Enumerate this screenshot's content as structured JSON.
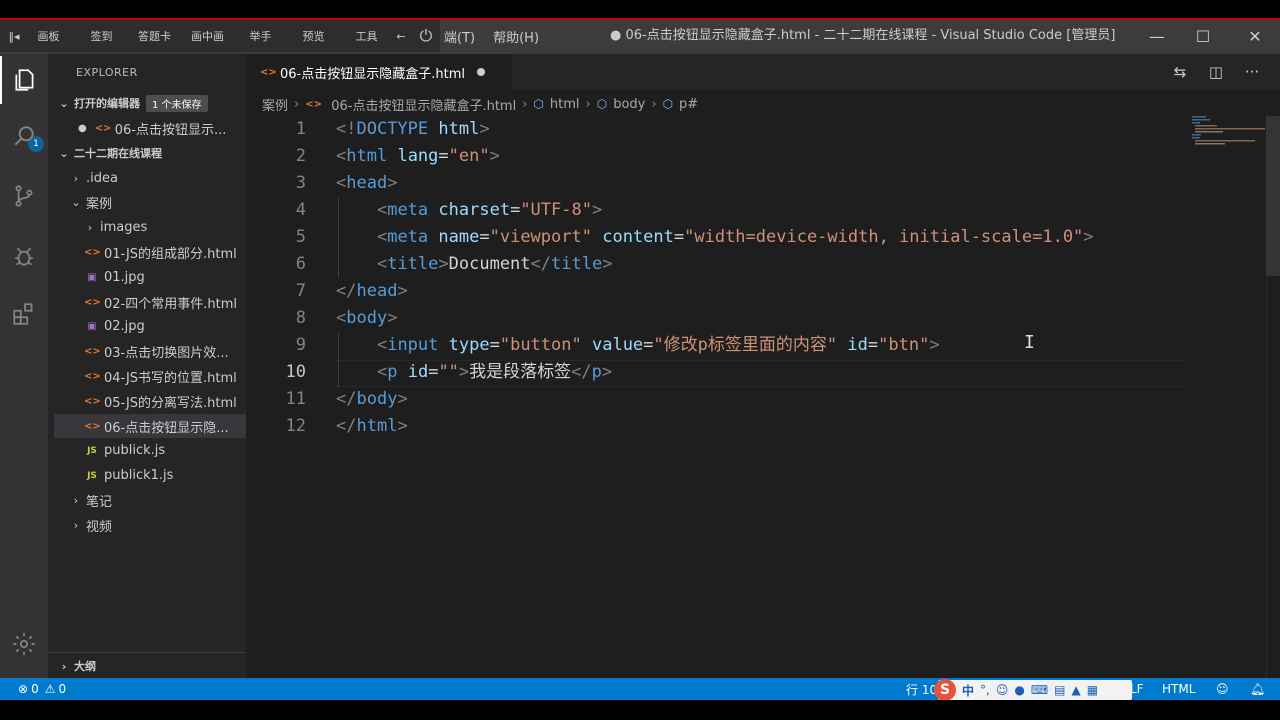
{
  "recorder_toolbar": {
    "items": [
      "画板",
      "签到",
      "答题卡",
      "画中画",
      "举手",
      "预览",
      "工具"
    ]
  },
  "menus": [
    "端(T)",
    "帮助(H)"
  ],
  "window": {
    "title": "● 06-点击按钮显示隐藏盒子.html - 二十二期在线课程 - Visual Studio Code [管理员]"
  },
  "activity": {
    "badge": "1"
  },
  "sidebar": {
    "title": "EXPLORER",
    "open_editors": {
      "label": "打开的编辑器",
      "badge": "1 个未保存",
      "item": "06-点击按钮显示..."
    },
    "workspace": "二十二期在线课程",
    "tree": [
      {
        "label": ".idea",
        "type": "folder",
        "depth": 1,
        "expanded": false
      },
      {
        "label": "案例",
        "type": "folder",
        "depth": 1,
        "expanded": true
      },
      {
        "label": "images",
        "type": "folder",
        "depth": 2,
        "expanded": false
      },
      {
        "label": "01-JS的组成部分.html",
        "type": "html",
        "depth": 2
      },
      {
        "label": "01.jpg",
        "type": "img",
        "depth": 2
      },
      {
        "label": "02-四个常用事件.html",
        "type": "html",
        "depth": 2
      },
      {
        "label": "02.jpg",
        "type": "img",
        "depth": 2
      },
      {
        "label": "03-点击切换图片效...",
        "type": "html",
        "depth": 2
      },
      {
        "label": "04-JS书写的位置.html",
        "type": "html",
        "depth": 2
      },
      {
        "label": "05-JS的分离写法.html",
        "type": "html",
        "depth": 2
      },
      {
        "label": "06-点击按钮显示隐...",
        "type": "html",
        "depth": 2,
        "selected": true
      },
      {
        "label": "publick.js",
        "type": "js",
        "depth": 2
      },
      {
        "label": "publick1.js",
        "type": "js",
        "depth": 2
      },
      {
        "label": "笔记",
        "type": "folder",
        "depth": 1,
        "expanded": false
      },
      {
        "label": "视频",
        "type": "folder",
        "depth": 1,
        "expanded": false
      }
    ],
    "outline": "大纲"
  },
  "tab": {
    "label": "06-点击按钮显示隐藏盒子.html"
  },
  "breadcrumb": {
    "items": [
      "案例",
      "06-点击按钮显示隐藏盒子.html",
      "html",
      "body",
      "p#"
    ]
  },
  "editor": {
    "current_line": 10,
    "lines": [
      [
        [
          "br",
          "<!"
        ],
        [
          "tag",
          "DOCTYPE"
        ],
        [
          "txt",
          " "
        ],
        [
          "attr",
          "html"
        ],
        [
          "br",
          ">"
        ]
      ],
      [
        [
          "br",
          "<"
        ],
        [
          "tag",
          "html"
        ],
        [
          "txt",
          " "
        ],
        [
          "attr",
          "lang"
        ],
        [
          "txt",
          "="
        ],
        [
          "str",
          "\"en\""
        ],
        [
          "br",
          ">"
        ]
      ],
      [
        [
          "br",
          "<"
        ],
        [
          "tag",
          "head"
        ],
        [
          "br",
          ">"
        ]
      ],
      [
        [
          "txt",
          "    "
        ],
        [
          "br",
          "<"
        ],
        [
          "tag",
          "meta"
        ],
        [
          "txt",
          " "
        ],
        [
          "attr",
          "charset"
        ],
        [
          "txt",
          "="
        ],
        [
          "str",
          "\"UTF-8\""
        ],
        [
          "br",
          ">"
        ]
      ],
      [
        [
          "txt",
          "    "
        ],
        [
          "br",
          "<"
        ],
        [
          "tag",
          "meta"
        ],
        [
          "txt",
          " "
        ],
        [
          "attr",
          "name"
        ],
        [
          "txt",
          "="
        ],
        [
          "str",
          "\"viewport\""
        ],
        [
          "txt",
          " "
        ],
        [
          "attr",
          "content"
        ],
        [
          "txt",
          "="
        ],
        [
          "str",
          "\"width=device-width, initial-scale=1.0\""
        ],
        [
          "br",
          ">"
        ]
      ],
      [
        [
          "txt",
          "    "
        ],
        [
          "br",
          "<"
        ],
        [
          "tag",
          "title"
        ],
        [
          "br",
          ">"
        ],
        [
          "txt",
          "Document"
        ],
        [
          "br",
          "</"
        ],
        [
          "tag",
          "title"
        ],
        [
          "br",
          ">"
        ]
      ],
      [
        [
          "br",
          "</"
        ],
        [
          "tag",
          "head"
        ],
        [
          "br",
          ">"
        ]
      ],
      [
        [
          "br",
          "<"
        ],
        [
          "tag",
          "body"
        ],
        [
          "br",
          ">"
        ]
      ],
      [
        [
          "txt",
          "    "
        ],
        [
          "br",
          "<"
        ],
        [
          "tag",
          "input"
        ],
        [
          "txt",
          " "
        ],
        [
          "attr",
          "type"
        ],
        [
          "txt",
          "="
        ],
        [
          "str",
          "\"button\""
        ],
        [
          "txt",
          " "
        ],
        [
          "attr",
          "value"
        ],
        [
          "txt",
          "="
        ],
        [
          "str",
          "\"修改p标签里面的内容\""
        ],
        [
          "txt",
          " "
        ],
        [
          "attr",
          "id"
        ],
        [
          "txt",
          "="
        ],
        [
          "str",
          "\"btn\""
        ],
        [
          "br",
          ">"
        ]
      ],
      [
        [
          "txt",
          "    "
        ],
        [
          "br",
          "<"
        ],
        [
          "tag",
          "p"
        ],
        [
          "txt",
          " "
        ],
        [
          "attr",
          "id"
        ],
        [
          "txt",
          "="
        ],
        [
          "str",
          "\"\""
        ],
        [
          "br",
          ">"
        ],
        [
          "txt",
          "我是段落标签"
        ],
        [
          "br",
          "</"
        ],
        [
          "tag",
          "p"
        ],
        [
          "br",
          ">"
        ]
      ],
      [
        [
          "br",
          "</"
        ],
        [
          "tag",
          "body"
        ],
        [
          "br",
          ">"
        ]
      ],
      [
        [
          "br",
          "</"
        ],
        [
          "tag",
          "html"
        ],
        [
          "br",
          ">"
        ]
      ]
    ]
  },
  "status": {
    "errors": "0",
    "warnings": "0",
    "position": "行 10",
    "eol": "LF",
    "language": "HTML"
  },
  "ime": {
    "logo": "S",
    "mode": "中"
  }
}
